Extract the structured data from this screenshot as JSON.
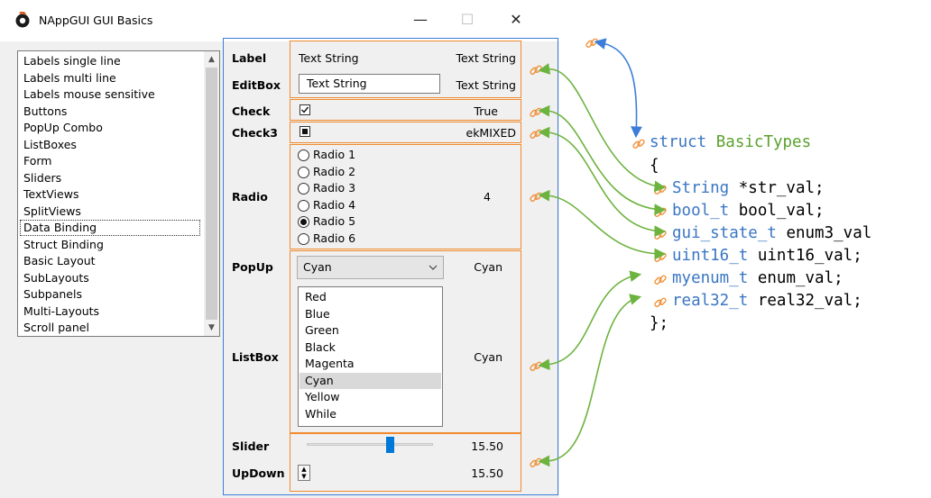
{
  "window": {
    "title": "NAppGUI GUI Basics",
    "controls": {
      "minimize": "—",
      "maximize": "☐",
      "close": "✕"
    }
  },
  "navlist": {
    "items": [
      "Labels single line",
      "Labels multi line",
      "Labels mouse sensitive",
      "Buttons",
      "PopUp Combo",
      "ListBoxes",
      "Form",
      "Sliders",
      "TextViews",
      "SplitViews",
      "Data Binding",
      "Struct Binding",
      "Basic Layout",
      "SubLayouts",
      "Subpanels",
      "Multi-Layouts",
      "Scroll panel"
    ],
    "selected_index": 10
  },
  "form": {
    "label": {
      "title": "Label",
      "text": "Text String",
      "value": "Text String"
    },
    "editbox": {
      "title": "EditBox",
      "text": "Text String",
      "value": "Text String"
    },
    "check": {
      "title": "Check",
      "checked": true,
      "value": "True"
    },
    "check3": {
      "title": "Check3",
      "state": "mixed",
      "value": "ekMIXED"
    },
    "radio": {
      "title": "Radio",
      "options": [
        "Radio 1",
        "Radio 2",
        "Radio 3",
        "Radio 4",
        "Radio 5",
        "Radio 6"
      ],
      "selected_index": 4,
      "value": "4"
    },
    "popup": {
      "title": "PopUp",
      "selected": "Cyan",
      "value": "Cyan"
    },
    "listbox": {
      "title": "ListBox",
      "items": [
        "Red",
        "Blue",
        "Green",
        "Black",
        "Magenta",
        "Cyan",
        "Yellow",
        "While"
      ],
      "selected_index": 5,
      "value": "Cyan"
    },
    "slider": {
      "title": "Slider",
      "level_fraction": 0.66,
      "value": "15.50"
    },
    "updown": {
      "title": "UpDown",
      "value": "15.50"
    }
  },
  "code": {
    "line1_kw": "struct",
    "line1_name": "BasicTypes",
    "open_brace": "{",
    "fields": [
      {
        "type": "String",
        "decl": " *str_val;"
      },
      {
        "type": "bool_t",
        "decl": " bool_val;"
      },
      {
        "type": "gui_state_t",
        "decl": " enum3_val"
      },
      {
        "type": "uint16_t",
        "decl": " uint16_val;"
      },
      {
        "type": "myenum_t",
        "decl": " enum_val;"
      },
      {
        "type": "real32_t",
        "decl": " real32_val;"
      }
    ],
    "close_brace": "};"
  },
  "colors": {
    "panel_border": "#3b7dd8",
    "binding_box": "#f08a2c",
    "arrow_green": "#6db33f",
    "arrow_blue": "#3b7dd8",
    "keyword": "#3a76c4"
  }
}
